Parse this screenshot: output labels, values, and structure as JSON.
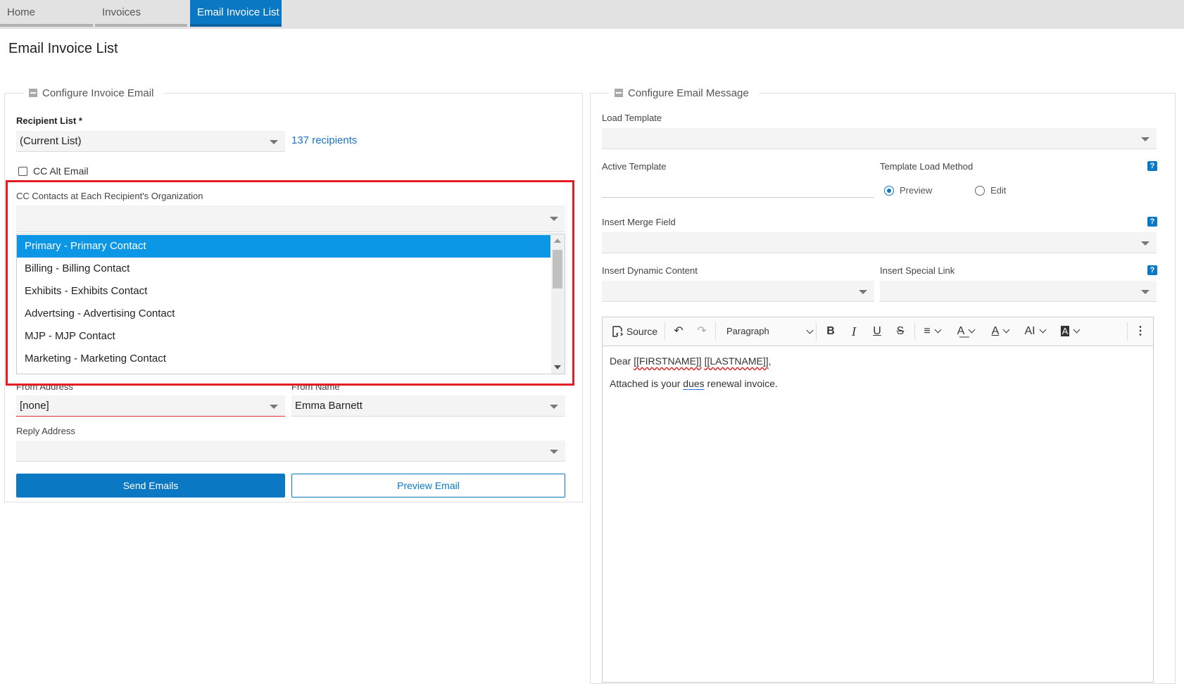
{
  "tabs": [
    {
      "label": "Home"
    },
    {
      "label": "Invoices"
    },
    {
      "label": "Email Invoice List"
    }
  ],
  "page_title": "Email Invoice List",
  "left_panel": {
    "legend": "Configure Invoice Email",
    "recipient_list_label": "Recipient List *",
    "recipient_list_value": "(Current List)",
    "recipient_count": "137 recipients",
    "cc_alt_email_label": "CC Alt Email",
    "cc_contacts_label": "CC Contacts at Each Recipient's Organization",
    "cc_contacts_options": [
      "Primary - Primary Contact",
      "Billing - Billing Contact",
      "Exhibits - Exhibits Contact",
      "Advertsing - Advertising Contact",
      "MJP - MJP Contact",
      "Marketing - Marketing Contact"
    ],
    "selected_option": "Primary - Primary Contact",
    "from_address_label": "From Address",
    "from_address_value": "[none]",
    "from_name_label": "From Name",
    "from_name_value": "Emma Barnett",
    "reply_address_label": "Reply Address",
    "reply_address_value": "",
    "send_button": "Send Emails",
    "preview_button": "Preview Email"
  },
  "right_panel": {
    "legend": "Configure Email Message",
    "load_template_label": "Load Template",
    "active_template_label": "Active Template",
    "template_load_method_label": "Template Load Method",
    "radio_preview": "Preview",
    "radio_edit": "Edit",
    "radio_selected": "Preview",
    "insert_merge_field_label": "Insert Merge Field",
    "insert_dynamic_content_label": "Insert Dynamic Content",
    "insert_special_link_label": "Insert Special Link",
    "help_icon": "?"
  },
  "editor": {
    "toolbar": {
      "source": "Source",
      "paragraph": "Paragraph",
      "bold": "B",
      "italic": "I",
      "underline": "U",
      "strike": "S"
    },
    "body": {
      "greeting_prefix": "Dear ",
      "firstname": "[[FIRSTNAME]]",
      "space": " ",
      "lastname": "[[LASTNAME]]",
      "greeting_suffix": ",",
      "line2_a": "Attached is your ",
      "line2_dues": "dues",
      "line2_b": " renewal invoice."
    }
  },
  "colors": {
    "accent": "#0b78c4",
    "selection": "#0b96e6",
    "highlight_box": "#e31d23"
  }
}
